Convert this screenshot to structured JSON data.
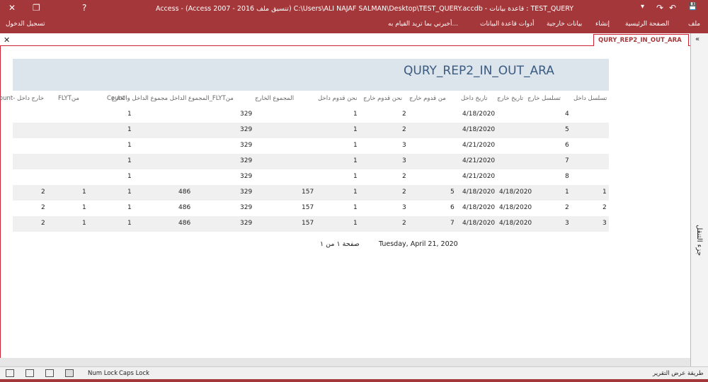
{
  "window": {
    "title": "Access - (Access 2007 - 2016 تنسيق ملف) C:\\Users\\ALI NAJAF SALMAN\\Desktop\\TEST_QUERY.accdb - قاعدة بيانات : TEST_QUERY",
    "close": "✕",
    "restore": "❐",
    "help": "?",
    "minimize": "–",
    "undo": "↶",
    "redo": "↷",
    "save": "💾",
    "more": "▾"
  },
  "ribbon": {
    "file": "ملف",
    "home": "الصفحة الرئيسية",
    "create": "إنشاء",
    "external": "بيانات خارجية",
    "dbtools": "أدوات قاعدة البيانات",
    "tell": "أخبرني بما تريد القيام به...",
    "signin": "تسجيل الدخول"
  },
  "doc_tab": {
    "label": "QURY_REP2_IN_OUT_ARA"
  },
  "nav_pane": {
    "label": "جزء التنقل",
    "toggle": "«"
  },
  "report": {
    "title": "QURY_REP2_IN_OUT_ARA",
    "headers": [
      "تسلسل داخل",
      "تسلسل خارج",
      "تاريخ خارج",
      "تاريخ داخل",
      "من قدوم خارج",
      "نحن قدوم خارج",
      "نحن قدوم داخل",
      "المجموع الخارج",
      "المجموع الداخل مجموع الداخل والخارج_FLYTمن",
      "Count",
      "FLYTمن",
      "Count- خارج داخل"
    ],
    "rows": [
      [
        "",
        "4",
        "",
        "4/18/2020",
        "2",
        "1",
        "",
        "329",
        "",
        "1",
        "",
        ""
      ],
      [
        "",
        "5",
        "",
        "4/18/2020",
        "2",
        "1",
        "",
        "329",
        "",
        "1",
        "",
        ""
      ],
      [
        "",
        "6",
        "",
        "4/21/2020",
        "3",
        "1",
        "",
        "329",
        "",
        "1",
        "",
        ""
      ],
      [
        "",
        "7",
        "",
        "4/21/2020",
        "3",
        "1",
        "",
        "329",
        "",
        "1",
        "",
        ""
      ],
      [
        "",
        "8",
        "",
        "4/21/2020",
        "2",
        "1",
        "",
        "329",
        "",
        "1",
        "",
        ""
      ],
      [
        "1",
        "1",
        "4/18/2020",
        "4/18/2020",
        "5",
        "2",
        "1",
        "157",
        "329",
        "486",
        "1",
        "1",
        "2"
      ],
      [
        "2",
        "2",
        "4/18/2020",
        "4/18/2020",
        "6",
        "3",
        "1",
        "157",
        "329",
        "486",
        "1",
        "1",
        "2"
      ],
      [
        "3",
        "3",
        "4/18/2020",
        "4/18/2020",
        "7",
        "2",
        "1",
        "157",
        "329",
        "486",
        "1",
        "1",
        "2"
      ]
    ],
    "footer": {
      "date": "Tuesday, April 21, 2020",
      "page": "صفحة ١ من ١"
    }
  },
  "status": {
    "numlock": "Num Lock",
    "capslock": "Caps Lock",
    "view": "طريقة عرض التقرير"
  }
}
